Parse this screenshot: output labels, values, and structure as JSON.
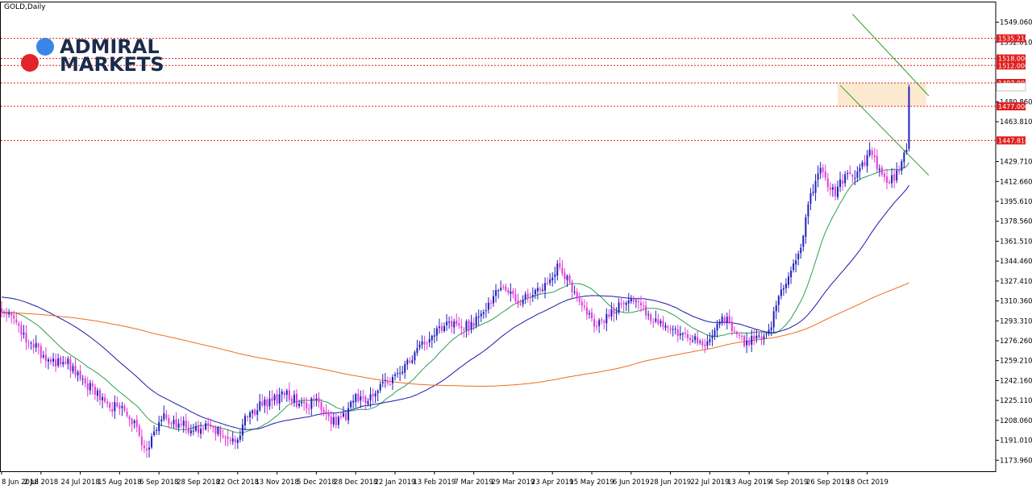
{
  "window": {
    "symbol_title": "GOLD,Daily"
  },
  "brand": {
    "line1": "ADMIRAL",
    "line2": "MARKETS",
    "dot_blue": "#3a86e8",
    "dot_red": "#e2232a",
    "text_color": "#1b2b4b"
  },
  "colors": {
    "bull_candle": "#1f1fbf",
    "bear_candle": "#e43ad8",
    "ma_fast": "#2e9e52",
    "ma_mid": "#1a1aa8",
    "ma_slow": "#f06b1f",
    "hline": "#e01f1f",
    "channel": "#2f9e2f",
    "zone": "#fbe5c8",
    "label_bg": "#e01f1f"
  },
  "chart_data": {
    "type": "candlestick",
    "title": "GOLD,Daily",
    "ylim": [
      1164.5,
      1566.0
    ],
    "y_ticks": [
      1173.96,
      1191.01,
      1208.06,
      1225.11,
      1242.16,
      1259.21,
      1276.26,
      1293.31,
      1310.36,
      1327.41,
      1344.46,
      1361.51,
      1378.56,
      1395.61,
      1412.66,
      1429.71,
      1463.81,
      1480.86,
      1532.01,
      1549.06
    ],
    "y_tick_labels": [
      "1173.960",
      "1191.010",
      "1208.060",
      "1225.110",
      "1242.160",
      "1259.210",
      "1276.260",
      "1293.310",
      "1310.360",
      "1327.410",
      "1344.460",
      "1361.510",
      "1378.560",
      "1395.610",
      "1412.660",
      "1429.710",
      "1463.810",
      "1480.860",
      "1532.010",
      "1549.060"
    ],
    "x_labels": [
      "8 Jun 2018",
      "2 Jul 2018",
      "24 Jul 2018",
      "15 Aug 2018",
      "6 Sep 2018",
      "28 Sep 2018",
      "22 Oct 2018",
      "13 Nov 2018",
      "5 Dec 2018",
      "28 Dec 2018",
      "22 Jan 2019",
      "13 Feb 2019",
      "7 Mar 2019",
      "29 Mar 2019",
      "23 Apr 2019",
      "15 May 2019",
      "6 Jun 2019",
      "28 Jun 2019",
      "22 Jul 2019",
      "13 Aug 2019",
      "4 Sep 2019",
      "26 Sep 2019",
      "18 Oct 2019"
    ],
    "bars_per_label": 16,
    "total_bars": 370,
    "last_close": 1493.6,
    "close_anchors": [
      [
        0,
        1297
      ],
      [
        4,
        1300
      ],
      [
        8,
        1282
      ],
      [
        14,
        1270
      ],
      [
        20,
        1258
      ],
      [
        26,
        1260
      ],
      [
        32,
        1245
      ],
      [
        38,
        1232
      ],
      [
        44,
        1220
      ],
      [
        50,
        1218
      ],
      [
        54,
        1205
      ],
      [
        56,
        1192
      ],
      [
        58,
        1180
      ],
      [
        62,
        1195
      ],
      [
        66,
        1210
      ],
      [
        72,
        1205
      ],
      [
        78,
        1200
      ],
      [
        84,
        1202
      ],
      [
        90,
        1196
      ],
      [
        94,
        1190
      ],
      [
        97,
        1198
      ],
      [
        100,
        1212
      ],
      [
        106,
        1222
      ],
      [
        112,
        1226
      ],
      [
        116,
        1232
      ],
      [
        120,
        1224
      ],
      [
        124,
        1220
      ],
      [
        128,
        1225
      ],
      [
        132,
        1212
      ],
      [
        136,
        1205
      ],
      [
        140,
        1212
      ],
      [
        144,
        1228
      ],
      [
        148,
        1225
      ],
      [
        152,
        1232
      ],
      [
        160,
        1247
      ],
      [
        166,
        1260
      ],
      [
        172,
        1275
      ],
      [
        178,
        1288
      ],
      [
        184,
        1292
      ],
      [
        190,
        1288
      ],
      [
        196,
        1300
      ],
      [
        202,
        1322
      ],
      [
        210,
        1310
      ],
      [
        216,
        1315
      ],
      [
        222,
        1328
      ],
      [
        226,
        1340
      ],
      [
        230,
        1328
      ],
      [
        234,
        1310
      ],
      [
        238,
        1300
      ],
      [
        242,
        1290
      ],
      [
        246,
        1298
      ],
      [
        250,
        1305
      ],
      [
        256,
        1315
      ],
      [
        260,
        1310
      ],
      [
        262,
        1298
      ],
      [
        266,
        1292
      ],
      [
        270,
        1292
      ],
      [
        274,
        1285
      ],
      [
        278,
        1278
      ],
      [
        282,
        1280
      ],
      [
        286,
        1272
      ],
      [
        290,
        1285
      ],
      [
        294,
        1296
      ],
      [
        298,
        1286
      ],
      [
        302,
        1275
      ],
      [
        306,
        1278
      ],
      [
        310,
        1282
      ],
      [
        313,
        1292
      ],
      [
        316,
        1316
      ],
      [
        320,
        1332
      ],
      [
        322,
        1342
      ],
      [
        325,
        1360
      ],
      [
        327,
        1380
      ],
      [
        330,
        1408
      ],
      [
        333,
        1425
      ],
      [
        336,
        1412
      ],
      [
        339,
        1402
      ],
      [
        342,
        1415
      ],
      [
        346,
        1418
      ],
      [
        350,
        1425
      ],
      [
        353,
        1440
      ],
      [
        356,
        1427
      ],
      [
        359,
        1415
      ],
      [
        362,
        1415
      ],
      [
        365,
        1420
      ],
      [
        368,
        1440
      ],
      [
        369,
        1493.6
      ]
    ],
    "ma_windows": {
      "fast": 20,
      "mid": 50,
      "slow": 200
    },
    "seed_mid": 1314,
    "seed_slow": 1300,
    "horizontal_levels": [
      {
        "value": 1535.21,
        "label": "1535.210"
      },
      {
        "value": 1518.0,
        "label": "1518.000"
      },
      {
        "value": 1512.0,
        "label": "1512.000"
      },
      {
        "value": 1497.0,
        "label": "1497.000"
      },
      {
        "value": 1477.0,
        "label": "1477.000"
      },
      {
        "value": 1447.816,
        "label": "1447.816"
      }
    ],
    "zone": {
      "from_bar": 340,
      "to_bar": 376,
      "low": 1477.0,
      "high": 1497.0
    },
    "channel_lines": [
      {
        "b1": 346,
        "v1": 1556.0,
        "b2": 377,
        "v2": 1486.0
      },
      {
        "b1": 341,
        "v1": 1495.0,
        "b2": 377,
        "v2": 1418.0
      }
    ],
    "grid": false,
    "legend": "none"
  }
}
